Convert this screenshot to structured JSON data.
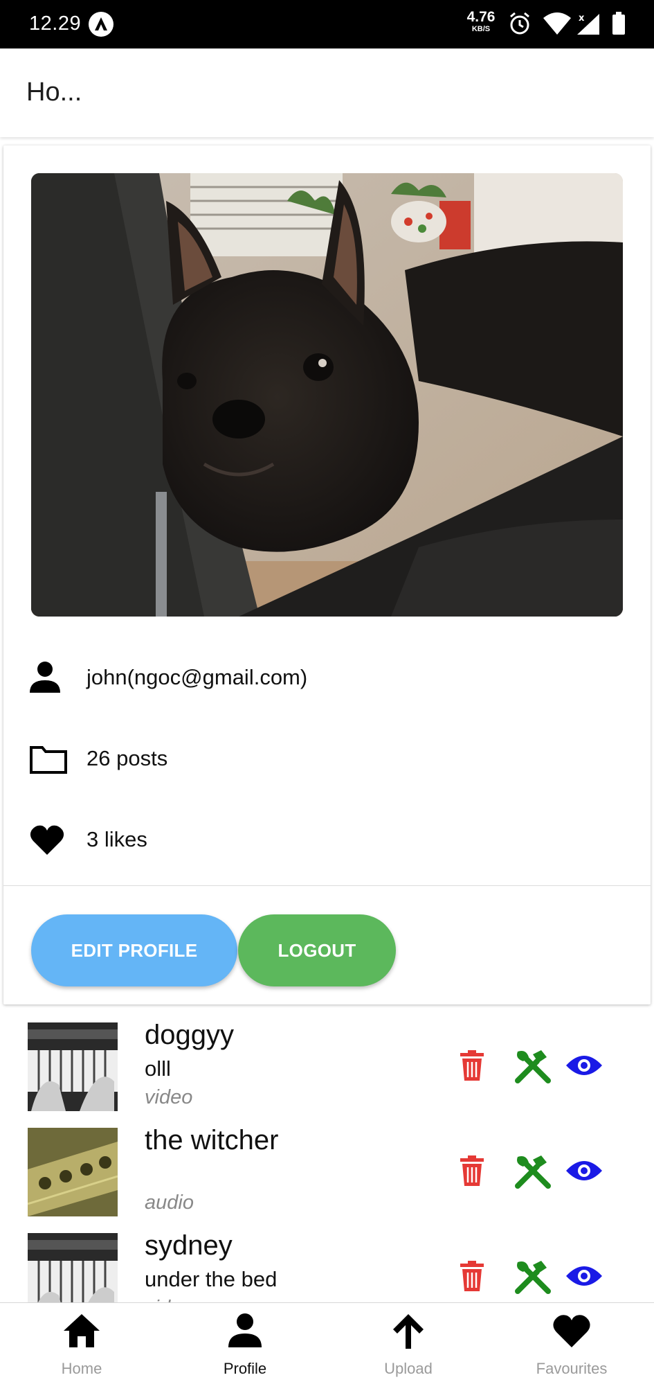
{
  "status_bar": {
    "time": "12.29",
    "speed_value": "4.76",
    "speed_unit": "KB/S"
  },
  "header": {
    "title": "Ho..."
  },
  "profile": {
    "user": "john(ngoc@gmail.com)",
    "posts": "26 posts",
    "likes": "3 likes",
    "edit_label": "EDIT PROFILE",
    "logout_label": "LOGOUT"
  },
  "posts": [
    {
      "title": "doggyy",
      "description": "olll",
      "type": "video"
    },
    {
      "title": "the witcher",
      "description": "",
      "type": "audio"
    },
    {
      "title": "sydney",
      "description": "under the bed",
      "type": "video"
    }
  ],
  "nav": [
    {
      "label": "Home",
      "icon": "home-icon"
    },
    {
      "label": "Profile",
      "icon": "person-icon"
    },
    {
      "label": "Upload",
      "icon": "arrow-up-icon"
    },
    {
      "label": "Favourites",
      "icon": "heart-icon"
    }
  ],
  "colors": {
    "edit": "#64b5f6",
    "logout": "#5cb85c",
    "delete": "#e53935",
    "modify": "#1e8c1e",
    "view": "#1a1ae6"
  }
}
